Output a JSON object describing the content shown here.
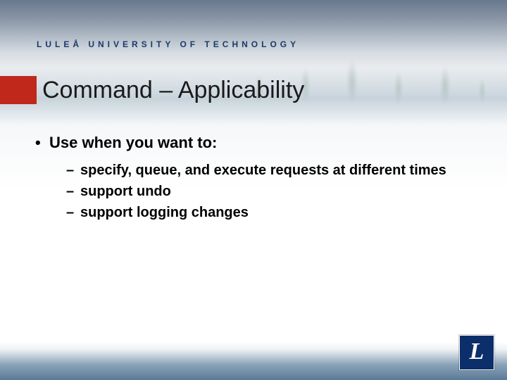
{
  "brand": {
    "line": "LULEÅ UNIVERSITY OF TECHNOLOGY"
  },
  "title": "Command – Applicability",
  "content": {
    "l1": "Use when you want to:",
    "subs": [
      "specify, queue, and execute requests at different times",
      "support undo",
      "support logging changes"
    ]
  },
  "logo": {
    "letter": "L"
  }
}
